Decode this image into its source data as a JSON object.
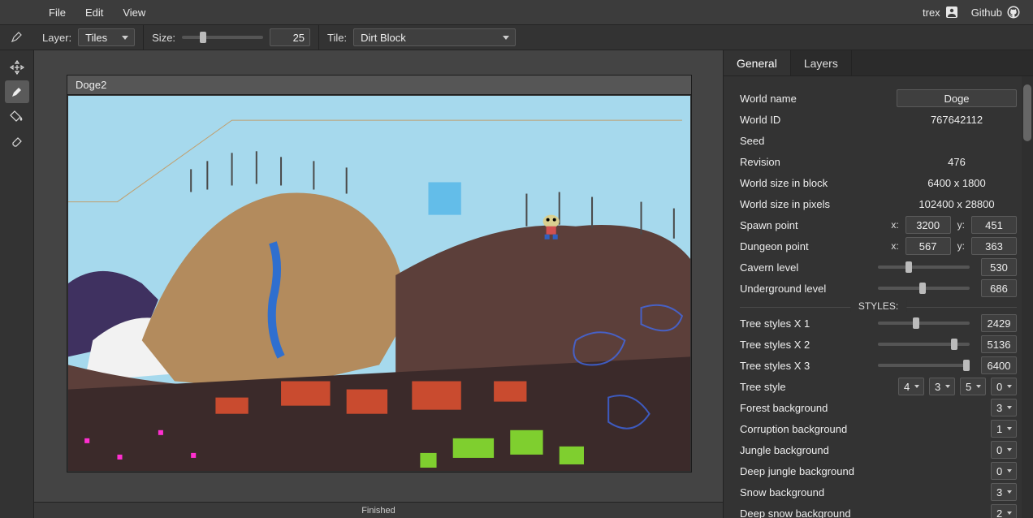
{
  "menu": {
    "file": "File",
    "edit": "Edit",
    "view": "View"
  },
  "header_right": {
    "brand": "trex",
    "github": "Github"
  },
  "toolbar": {
    "layer_label": "Layer:",
    "layer_value": "Tiles",
    "size_label": "Size:",
    "size_value": "25",
    "size_slider_percent": 22,
    "tile_label": "Tile:",
    "tile_value": "Dirt Block"
  },
  "tools": {
    "move": "move",
    "pencil": "pencil",
    "bucket": "bucket",
    "eraser": "eraser"
  },
  "canvas": {
    "title": "Doge2"
  },
  "status": {
    "text": "Finished"
  },
  "tabs": {
    "general": "General",
    "layers": "Layers"
  },
  "props": {
    "world_name_label": "World name",
    "world_name": "Doge",
    "world_id_label": "World ID",
    "world_id": "767642112",
    "seed_label": "Seed",
    "seed": "",
    "revision_label": "Revision",
    "revision": "476",
    "size_block_label": "World size in block",
    "size_block": "6400 x 1800",
    "size_pixels_label": "World size in pixels",
    "size_pixels": "102400 x 28800",
    "spawn_label": "Spawn point",
    "spawn_x": "3200",
    "spawn_y": "451",
    "dungeon_label": "Dungeon point",
    "dungeon_x": "567",
    "dungeon_y": "363",
    "cavern_label": "Cavern level",
    "cavern": "530",
    "cavern_percent": 30,
    "underground_label": "Underground level",
    "underground": "686",
    "underground_percent": 45,
    "styles_header": "STYLES:",
    "tree_x1_label": "Tree styles X 1",
    "tree_x1": "2429",
    "tree_x1_percent": 38,
    "tree_x2_label": "Tree styles X 2",
    "tree_x2": "5136",
    "tree_x2_percent": 80,
    "tree_x3_label": "Tree styles X 3",
    "tree_x3": "6400",
    "tree_x3_percent": 100,
    "tree_style_label": "Tree style",
    "tree_style_a": "4",
    "tree_style_b": "3",
    "tree_style_c": "5",
    "tree_style_d": "0",
    "forest_bg_label": "Forest background",
    "forest_bg": "3",
    "corruption_bg_label": "Corruption background",
    "corruption_bg": "1",
    "jungle_bg_label": "Jungle background",
    "jungle_bg": "0",
    "deep_jungle_bg_label": "Deep jungle background",
    "deep_jungle_bg": "0",
    "snow_bg_label": "Snow background",
    "snow_bg": "3",
    "deep_snow_bg_label": "Deep snow background",
    "deep_snow_bg": "2",
    "x_label": "x:",
    "y_label": "y:"
  }
}
